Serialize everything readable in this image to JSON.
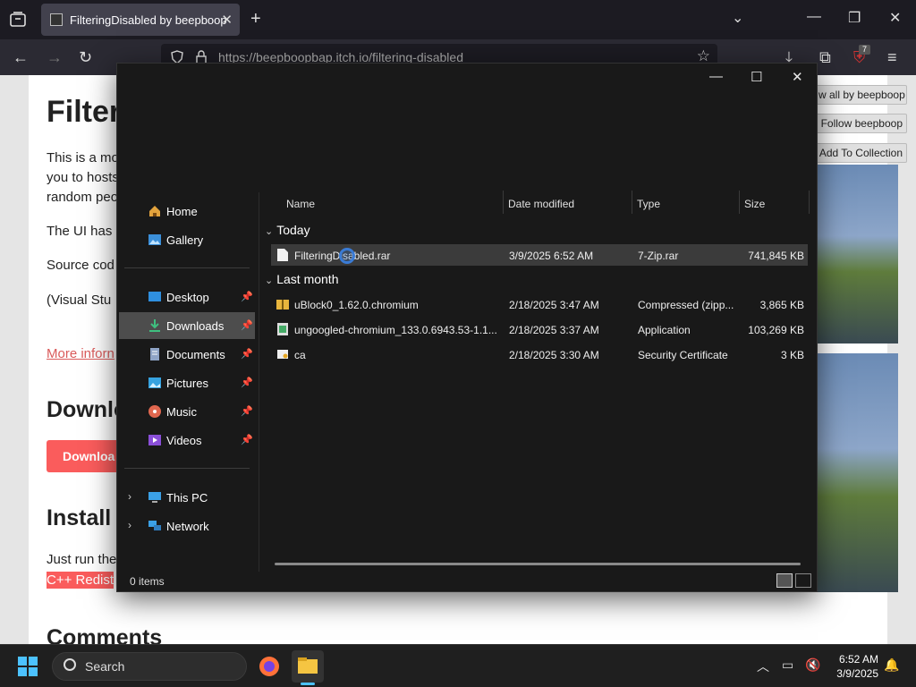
{
  "browser": {
    "tab_title": "FilteringDisabled by beepboop",
    "url_host": "https://beepboopbap.itch.io",
    "url_path": "/filtering-disabled",
    "extension_badge": "7"
  },
  "page": {
    "title": "Filter",
    "paragraph1_l1": "This is a mo",
    "paragraph1_l2": "you to hosts",
    "paragraph1_l3": "random peo",
    "paragraph2": "The UI has",
    "paragraph3": "Source cod",
    "paragraph4": "(Visual Stu",
    "more_info_link": "More inforn",
    "download_heading": "Downlo",
    "download_button": "Downloa",
    "install_heading": "Install i",
    "install_text": "Just run the",
    "install_highlight": "C++ Redist",
    "comments_heading": "Comments",
    "side_buttons": [
      "w all by beepboop",
      "Follow beepboop",
      "Add To Collection"
    ]
  },
  "explorer": {
    "nav": {
      "home": "Home",
      "gallery": "Gallery",
      "desktop": "Desktop",
      "downloads": "Downloads",
      "documents": "Documents",
      "pictures": "Pictures",
      "music": "Music",
      "videos": "Videos",
      "this_pc": "This PC",
      "network": "Network"
    },
    "columns": {
      "name": "Name",
      "date": "Date modified",
      "type": "Type",
      "size": "Size"
    },
    "groups": {
      "today": "Today",
      "last_month": "Last month"
    },
    "files_today": [
      {
        "name": "FilteringDisabled.rar",
        "date": "3/9/2025 6:52 AM",
        "type": "7-Zip.rar",
        "size": "741,845 KB"
      }
    ],
    "files_last_month": [
      {
        "name": "uBlock0_1.62.0.chromium",
        "date": "2/18/2025 3:47 AM",
        "type": "Compressed (zipp...",
        "size": "3,865 KB"
      },
      {
        "name": "ungoogled-chromium_133.0.6943.53-1.1...",
        "date": "2/18/2025 3:37 AM",
        "type": "Application",
        "size": "103,269 KB"
      },
      {
        "name": "ca",
        "date": "2/18/2025 3:30 AM",
        "type": "Security Certificate",
        "size": "3 KB"
      }
    ],
    "status": "0 items"
  },
  "taskbar": {
    "search_placeholder": "Search",
    "time": "6:52 AM",
    "date": "3/9/2025"
  }
}
